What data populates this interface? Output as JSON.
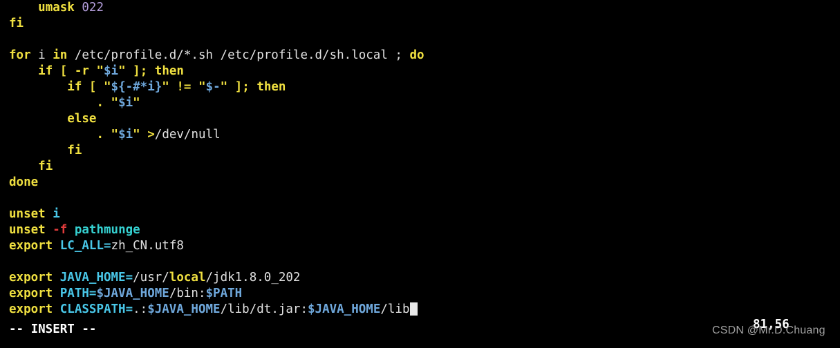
{
  "terminal": {
    "background_color": "#000000",
    "foreground_color": "#d8d8d8",
    "editor": "vim",
    "lines": [
      {
        "indent": "    ",
        "text": "umask 022"
      },
      {
        "indent": "",
        "text": "fi"
      },
      {
        "indent": "",
        "text": ""
      },
      {
        "indent": "",
        "text": "for i in /etc/profile.d/*.sh /etc/profile.d/sh.local ; do"
      },
      {
        "indent": "    ",
        "text": "if [ -r \"$i\" ]; then"
      },
      {
        "indent": "        ",
        "text": "if [ \"${-#*i}\" != \"$-\" ]; then"
      },
      {
        "indent": "            ",
        "text": ". \"$i\""
      },
      {
        "indent": "        ",
        "text": "else"
      },
      {
        "indent": "            ",
        "text": ". \"$i\" >/dev/null"
      },
      {
        "indent": "        ",
        "text": "fi"
      },
      {
        "indent": "    ",
        "text": "fi"
      },
      {
        "indent": "",
        "text": "done"
      },
      {
        "indent": "",
        "text": ""
      },
      {
        "indent": "",
        "text": "unset i"
      },
      {
        "indent": "",
        "text": "unset -f pathmunge"
      },
      {
        "indent": "",
        "text": "export LC_ALL=zh_CN.utf8"
      },
      {
        "indent": "",
        "text": ""
      },
      {
        "indent": "",
        "text": "export JAVA_HOME=/usr/local/jdk1.8.0_202"
      },
      {
        "indent": "",
        "text": "export PATH=$JAVA_HOME/bin:$PATH"
      },
      {
        "indent": "",
        "text": "export CLASSPATH=.:$JAVA_HOME/lib/dt.jar:$JAVA_HOME/lib"
      }
    ],
    "tokens": {
      "l1_umask": "umask",
      "l1_space": " ",
      "l1_022": "022",
      "l2_fi": "fi",
      "l4_for": "for",
      "l4_i": " i ",
      "l4_in": "in",
      "l4_paths": " /etc/profile.d/*.sh /etc/profile.d/sh.local ",
      "l4_semi": ";",
      "l4_sp": " ",
      "l4_do": "do",
      "l5_if": "if",
      "l5_br": " [ ",
      "l5_r": "-r",
      "l5_sp": " ",
      "l5_q1": "\"",
      "l5_i": "$i",
      "l5_q2": "\"",
      "l5_close": " ];",
      "l5_then": "then",
      "l6_if": "if",
      "l6_br": " [ ",
      "l6_q1": "\"",
      "l6_expr": "${-#*i}",
      "l6_q2": "\"",
      "l6_neq": " != ",
      "l6_q3": "\"",
      "l6_dash": "$-",
      "l6_q4": "\"",
      "l6_close": " ];",
      "l6_then": "then",
      "l7_dot": ".",
      "l7_q1": " \"",
      "l7_i": "$i",
      "l7_q2": "\"",
      "l8_else": "else",
      "l9_dot": ".",
      "l9_q1": " \"",
      "l9_i": "$i",
      "l9_q2": "\"",
      "l9_redir": ">",
      "l9_devnull": "/dev/null",
      "l10_fi": "fi",
      "l11_fi": "fi",
      "l12_done": "done",
      "l14_unset": "unset",
      "l14_i": "i",
      "l15_unset": "unset",
      "l15_f": "-f",
      "l15_pathmunge": "pathmunge",
      "l16_export": "export",
      "l16_var": "LC_ALL=",
      "l16_val": "zh_CN.utf8",
      "l18_export": "export",
      "l18_var": "JAVA_HOME=",
      "l18_usr": "/usr/",
      "l18_local": "local",
      "l18_jdk": "/jdk1.8.0_202",
      "l19_export": "export",
      "l19_var": "PATH=",
      "l19_jh": "$JAVA_HOME",
      "l19_bin": "/bin:",
      "l19_path": "$PATH",
      "l20_export": "export",
      "l20_var": "CLASSPATH=",
      "l20_dot": ".:",
      "l20_jh1": "$JAVA_HOME",
      "l20_lib1": "/lib/dt.jar:",
      "l20_jh2": "$JAVA_HOME",
      "l20_lib2": "/lib"
    }
  },
  "status": {
    "mode": "-- INSERT --",
    "ruler": "81,56"
  },
  "watermark": {
    "text": "CSDN @Mr.D.Chuang"
  }
}
